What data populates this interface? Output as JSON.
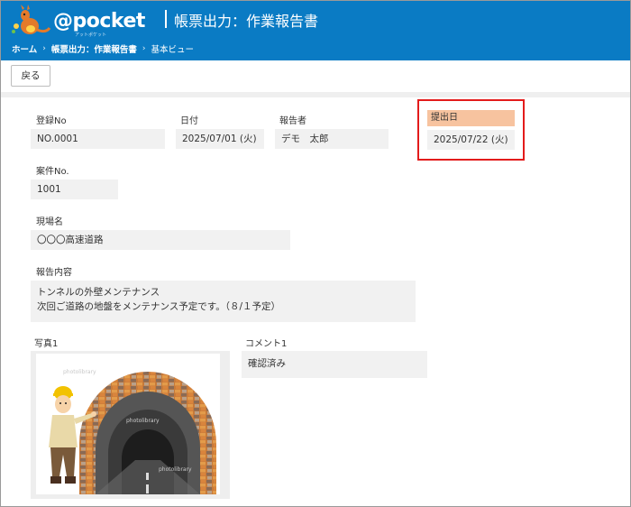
{
  "header": {
    "logo_text": "@pocket",
    "logo_sub": "アットポケット",
    "title": "帳票出力：作業報告書",
    "breadcrumb": [
      "ホーム",
      "帳票出力：作業報告書",
      "基本ビュー"
    ]
  },
  "toolbar": {
    "back_label": "戻る"
  },
  "fields": {
    "reg_no": {
      "label": "登録No",
      "value": "NO.0001"
    },
    "date": {
      "label": "日付",
      "value": "2025/07/01 (火)"
    },
    "reporter": {
      "label": "報告者",
      "value": "デモ　太郎"
    },
    "submit_date": {
      "label": "提出日",
      "value": "2025/07/22 (火)"
    },
    "case_no": {
      "label": "案件No.",
      "value": "1001"
    },
    "site_name": {
      "label": "現場名",
      "value": "〇〇〇高速道路"
    },
    "report_content": {
      "label": "報告内容",
      "line1": "トンネルの外壁メンテナンス",
      "line2": "次回ご道路の地盤をメンテナンス予定です。（８/１予定）"
    },
    "photo1": {
      "label": "写真1",
      "watermark": "photolibrary"
    },
    "comment1": {
      "label": "コメント1",
      "value": "確認済み"
    }
  },
  "colors": {
    "header_bg": "#0a7bc4",
    "highlight_border": "#e31b1b",
    "accent_label": "#f7c39f",
    "field_bg": "#f1f1f1"
  }
}
